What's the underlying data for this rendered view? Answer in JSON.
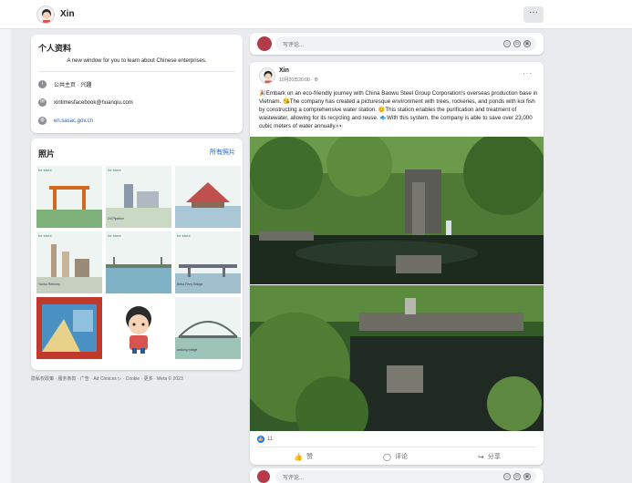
{
  "header": {
    "name": "Xin",
    "more_label": "···"
  },
  "profile": {
    "title": "个人资料",
    "description": "A new window for you to learn about Chinese enterprises.",
    "category": "公共主页 · 兴趣",
    "email": "xintimesfacebook@huanqiu.com",
    "website": "en.sasac.gov.cn"
  },
  "photos": {
    "title": "照片",
    "all_label": "所有照片",
    "tiles": [
      {
        "label": "for\nstore"
      },
      {
        "label": "for\nstore",
        "caption": "Zili Pipeline"
      },
      {
        "label": ""
      },
      {
        "label": "for\nstore",
        "caption": "Yanbu Refinery"
      },
      {
        "label": "for\nstore"
      },
      {
        "label": "for\nstore",
        "caption": "Beira Ferry Bridge"
      },
      {
        "label": ""
      },
      {
        "label": ""
      },
      {
        "label": "",
        "caption": "walking bridge"
      }
    ]
  },
  "footer": {
    "text": "隐私权政策 · 服务条款 · 广告 · Ad Choices ▷ · Cookie · 更多 · Meta © 2023"
  },
  "composer": {
    "placeholder": "写评论..."
  },
  "post": {
    "author": "Xin",
    "date": "10月20日20:00 · ⊕",
    "more_label": "···",
    "text": "🎉Embark on an eco-friendly journey with China Baowu Steel Group Corporation's overseas production base in Vietnam. 😘The company has created a picturesque environment with trees, rockeries, and ponds with koi fish by constructing a comprehensive water station. 😊This station enables the purification and treatment of wastewater, allowing for its recycling and reuse. 🐟With this system, the company is able to save over 23,000 cubic meters of water annually.👀",
    "like_count": "11",
    "actions": {
      "like": "赞",
      "comment": "评论",
      "share": "分享"
    }
  },
  "colors": {
    "link": "#1a5fc4",
    "like": "#1877f2"
  },
  "icons": [
    "info-icon",
    "mail-icon",
    "globe-icon",
    "like-icon",
    "comment-icon",
    "share-icon"
  ]
}
